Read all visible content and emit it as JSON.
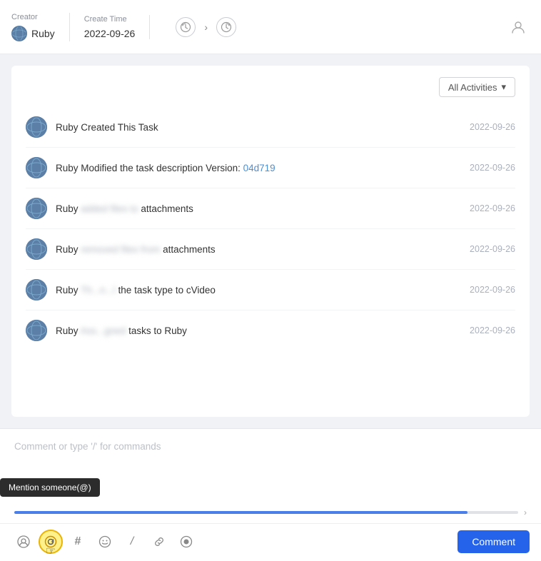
{
  "header": {
    "creator_label": "Creator",
    "creator_name": "Ruby",
    "create_time_label": "Create Time",
    "create_time_value": "2022-09-26",
    "assign_user_icon": "👤"
  },
  "filter": {
    "label": "All Activities",
    "dropdown_icon": "▾"
  },
  "activities": [
    {
      "id": 1,
      "text_parts": [
        {
          "type": "normal",
          "text": "Ruby Created This Task"
        }
      ],
      "date": "2022-09-26"
    },
    {
      "id": 2,
      "text_before": "Ruby Modified the task description Version: ",
      "link_text": "04d719",
      "text_after": "",
      "date": "2022-09-26",
      "has_link": true
    },
    {
      "id": 3,
      "text_prefix": "Ruby",
      "text_blurred": " added  ",
      "text_suffix": "attachments",
      "date": "2022-09-26",
      "has_blurred": true
    },
    {
      "id": 4,
      "text_prefix": "Ruby",
      "text_blurred": " deleted  ",
      "text_suffix": "attachments",
      "date": "2022-09-26",
      "has_blurred": true
    },
    {
      "id": 5,
      "text_prefix": "Ruby",
      "text_blurred": " changed  the task type to cVideo",
      "text_suffix": "",
      "date": "2022-09-26",
      "has_blurred2": true
    },
    {
      "id": 6,
      "text_prefix": "Ruby",
      "text_blurred": " assigned tasks to Ruby",
      "text_suffix": "",
      "date": "2022-09-26",
      "has_blurred2": true
    }
  ],
  "comment": {
    "placeholder": "Comment or type '/' for commands",
    "button_label": "Comment"
  },
  "tooltip": {
    "text": "Mention someone(@)"
  },
  "toolbar": {
    "icons": [
      {
        "name": "mention-icon",
        "symbol": "@",
        "active": false
      },
      {
        "name": "mention-at-icon",
        "symbol": "⊕",
        "active": true,
        "tooltip": "Mention someone(@)"
      },
      {
        "name": "hashtag-icon",
        "symbol": "#",
        "active": false
      },
      {
        "name": "emoji-icon",
        "symbol": "😊",
        "active": false
      },
      {
        "name": "slash-icon",
        "symbol": "/",
        "active": false
      },
      {
        "name": "link-icon",
        "symbol": "🔗",
        "active": false
      },
      {
        "name": "record-icon",
        "symbol": "⏺",
        "active": false
      }
    ]
  },
  "progress": {
    "fill_percent": 90
  }
}
